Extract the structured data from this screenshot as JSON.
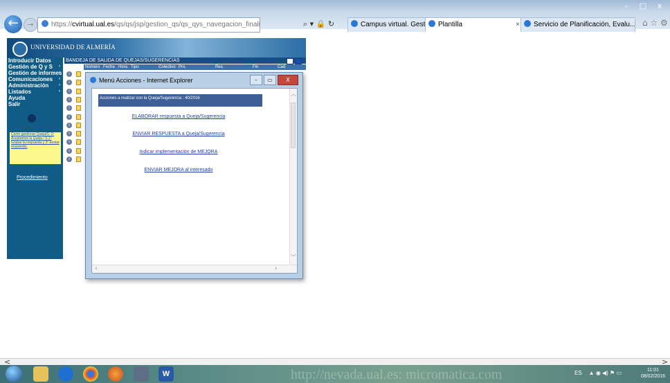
{
  "browser": {
    "url_prefix": "https://",
    "url_host": "cvirtual.ual.es",
    "url_path": "/qs/qs/jsp/gestion_qs/qs_qys_navegacion_finalizados.jsp",
    "addr_controls": "⌕ ▾ 🔒 ↻",
    "tabs": [
      {
        "label": "Campus virtual. Gestión de Qu..."
      },
      {
        "label": "Plantilla",
        "close": "×"
      },
      {
        "label": "Servicio de Planificación, Evalu..."
      }
    ],
    "window_controls": {
      "minimize": "–",
      "maximize": "□",
      "close": "x"
    },
    "home_icons": "⌂ ☆ ⚙"
  },
  "site": {
    "banner_title": "UNIVERSIDAD DE ALMERÍA"
  },
  "sidebar": {
    "items": [
      {
        "label": "Introducir Datos",
        "arrow": ""
      },
      {
        "label": "Gestión de Q y S",
        "arrow": "›"
      },
      {
        "label": "Gestión de informes",
        "arrow": "›"
      },
      {
        "label": "Comunicaciones",
        "arrow": "›"
      },
      {
        "label": "Administración",
        "arrow": "›"
      },
      {
        "label": "Listados",
        "arrow": "›"
      },
      {
        "label": "Ayuda",
        "arrow": ""
      },
      {
        "label": "Salir",
        "arrow": ""
      }
    ],
    "note_text": "Como gestionar Queja/S: 1º Aceptamos la Queja / S 2º Grabar la respuesta y 3º Enviar respuesta.",
    "procedure_link": "Procedimiento"
  },
  "main": {
    "header_title": "BANDEJA DE SALIDA DE QUEJAS/SUGERENCIAS",
    "columns": [
      "Número",
      "Fecha",
      "Hora",
      "Tipo",
      "Colectivo",
      "Pro.",
      "Res.",
      "Fin",
      "Cad."
    ],
    "row_count": 11,
    "row_info_icon": "i"
  },
  "popup": {
    "title": "Menú Acciones - Internet Explorer",
    "banner": "Acciones a realizar con la Queja/Sugerencia : 40/2016",
    "links": [
      "ELABORAR respuesta a Queja/Sugerencia",
      "ENVIAR RESPUESTA a Queja/Sugerencia",
      "Indicar implementación de MEJORA",
      "ENVIAR MEJORA al interesado"
    ],
    "controls": {
      "minimize": "–",
      "maximize": "▭",
      "close": "X"
    },
    "scroll_up": "︿",
    "scroll_down": "﹀",
    "scroll_left": "‹",
    "scroll_right": "›"
  },
  "page_scroll": {
    "left": "<",
    "right": ">"
  },
  "taskbar": {
    "word_label": "W",
    "watermark": "http://nevada.ual.es: micromatica.com",
    "language": "ES",
    "tray_icons": "▲ ◉ ◀) ⚑ ▭",
    "time": "11:01",
    "date": "08/02/2016"
  }
}
